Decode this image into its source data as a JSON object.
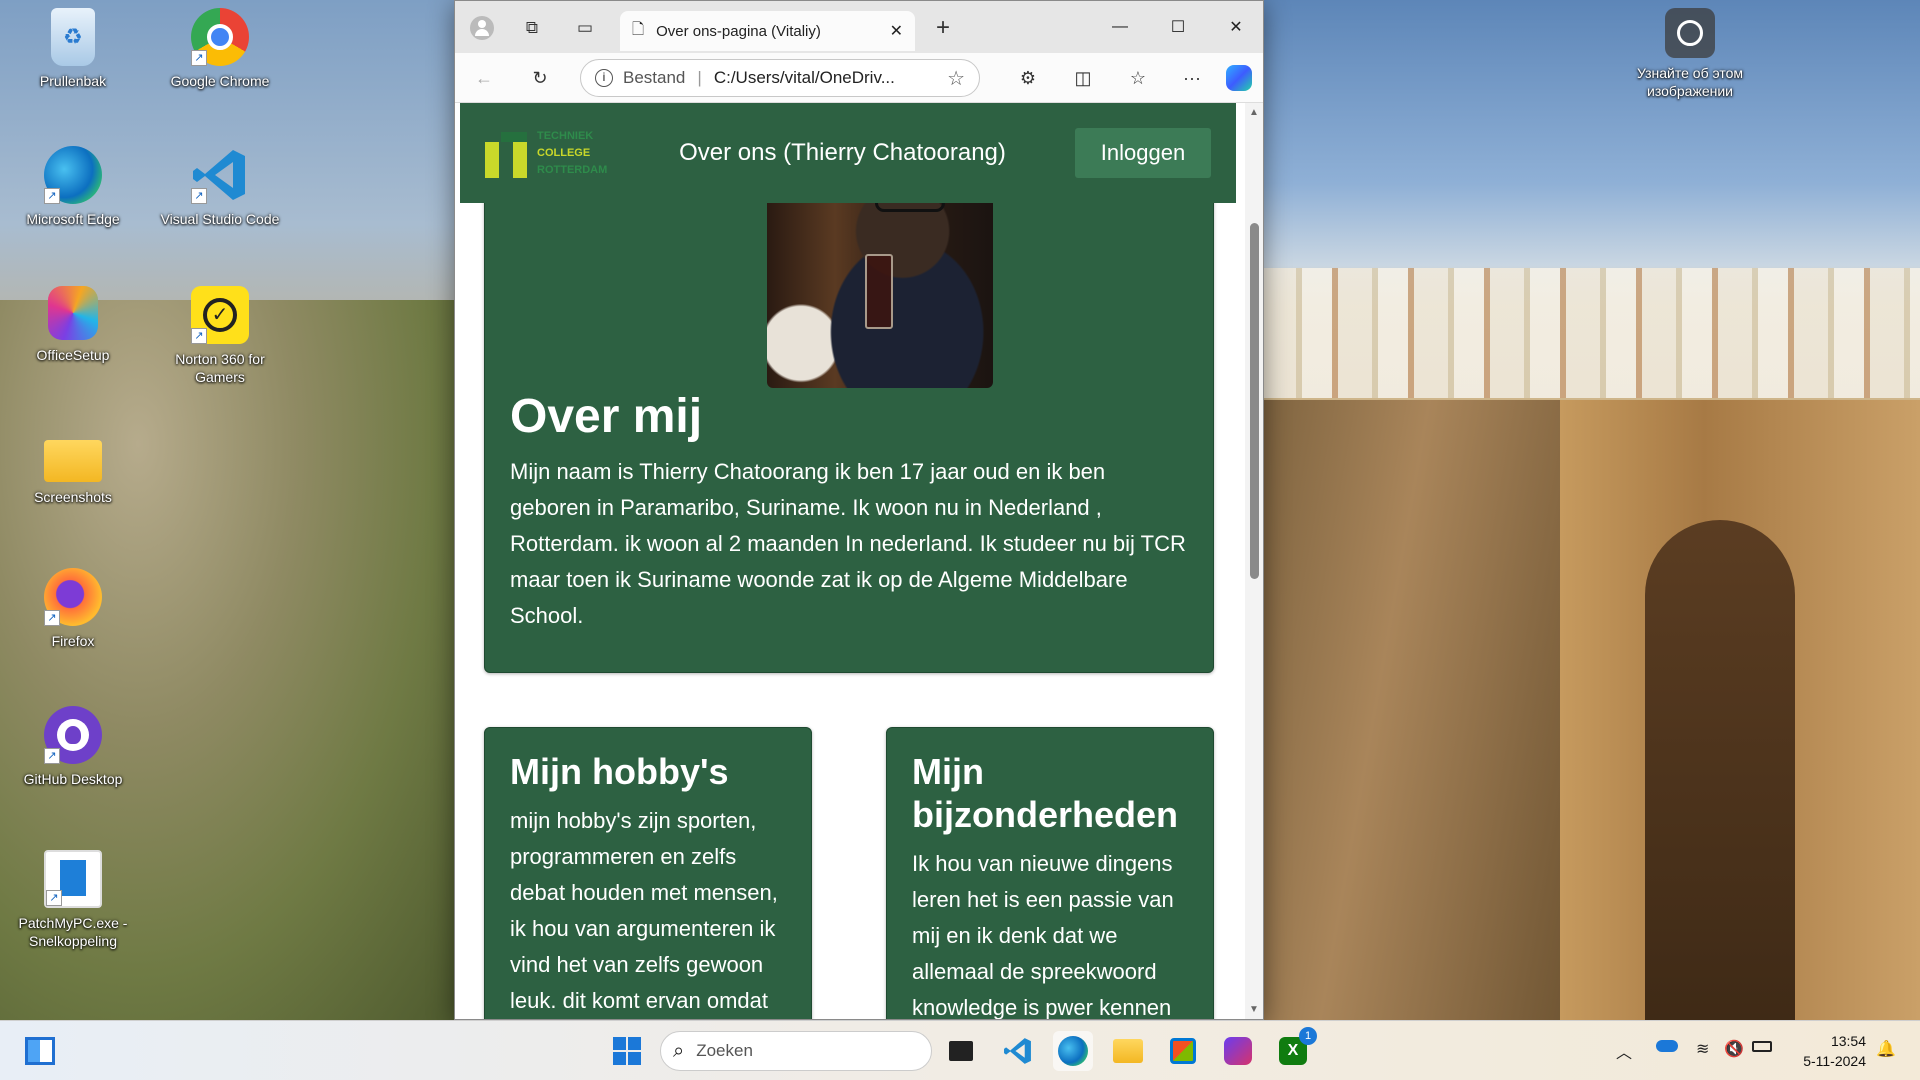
{
  "desktop": {
    "icons": [
      {
        "label": "Prullenbak"
      },
      {
        "label": "Google Chrome"
      },
      {
        "label": "Microsoft Edge"
      },
      {
        "label": "Visual Studio Code"
      },
      {
        "label": "OfficeSetup"
      },
      {
        "label": "Norton 360 for Gamers"
      },
      {
        "label": "Screenshots"
      },
      {
        "label": "Firefox"
      },
      {
        "label": "GitHub Desktop"
      },
      {
        "label": "PatchMyPC.exe - Snelkoppeling"
      }
    ],
    "right_widget_label": "Узнайте об этом изображении"
  },
  "browser": {
    "tab_title": "Over ons-pagina (Vitaliy)",
    "address_security_label": "Bestand",
    "address_url": "C:/Users/vital/OneDriv..."
  },
  "page": {
    "header": {
      "logo_lines": [
        "TECHNIEK",
        "COLLEGE",
        "ROTTERDAM"
      ],
      "title": "Over ons (Thierry Chatoorang)",
      "login_label": "Inloggen"
    },
    "about": {
      "heading": "Over mij",
      "text": "Mijn naam is Thierry Chatoorang ik ben 17 jaar oud en ik ben geboren in Paramaribo, Suriname. Ik woon nu in Nederland , Rotterdam. ik woon al 2 maanden In nederland. Ik studeer nu bij TCR maar toen ik Suriname woonde zat ik op de Algeme Middelbare School."
    },
    "hobbies": {
      "heading": "Mijn hobby's",
      "text": "mijn hobby's zijn sporten, programmeren en zelfs debat houden met mensen, ik hou van argumenteren ik vind het van zelfs gewoon leuk. dit komt ervan omdat"
    },
    "details": {
      "heading": "Mijn bijzonderheden",
      "text": "Ik hou van nieuwe dingens leren het is een passie van mij en ik denk dat we allemaal de spreekwoord knowledge is pwer kennen"
    }
  },
  "taskbar": {
    "search_placeholder": "Zoeken",
    "time": "13:54",
    "date": "5-11-2024",
    "store_badge": "1"
  },
  "colors": {
    "site_green": "#2d6142",
    "login_button": "#3c7b56",
    "logo_yellow": "#c9d82a"
  }
}
